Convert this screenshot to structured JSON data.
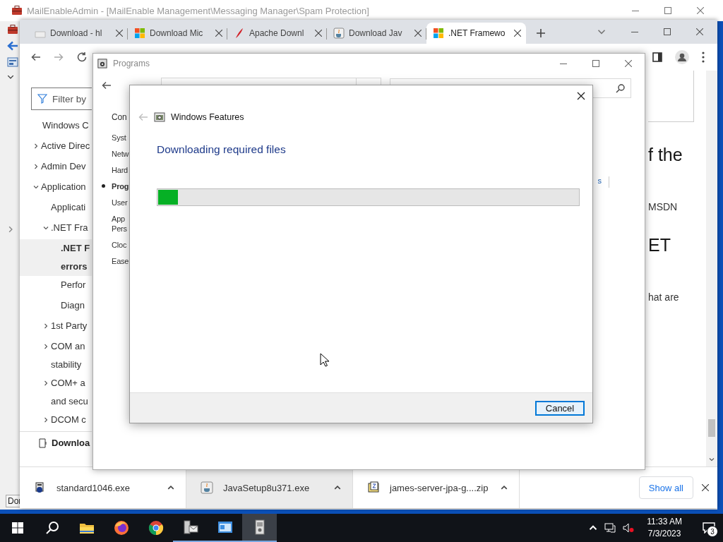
{
  "mail_window": {
    "title": "MailEnableAdmin - [MailEnable Management\\Messaging Manager\\Spam Protection]",
    "status_text": "Dor"
  },
  "browser": {
    "tabs": [
      {
        "label": "Download - hl",
        "selected": false
      },
      {
        "label": "Download Mic",
        "selected": false
      },
      {
        "label": "Apache Downl",
        "selected": false
      },
      {
        "label": "Download Jav",
        "selected": false
      },
      {
        "label": ".NET Framewo",
        "selected": true
      }
    ],
    "docs_sidebar": {
      "filter_placeholder": "Filter by",
      "tree": [
        {
          "lines": [
            "Windows C"
          ],
          "selected": false
        },
        {
          "lines": [
            "Active Direc"
          ],
          "expanded": false,
          "selected": false
        },
        {
          "lines": [
            "Admin Dev"
          ],
          "expanded": false,
          "selected": false
        },
        {
          "lines": [
            "Application"
          ],
          "expanded": true,
          "selected": false,
          "children": [
            {
              "lines": [
                "Applicati"
              ],
              "selected": false
            },
            {
              "lines": [
                ".NET Fra"
              ],
              "expanded": true,
              "selected": false,
              "children": [
                {
                  "lines": [
                    ".NET F",
                    "errors"
                  ],
                  "selected": true
                },
                {
                  "lines": [
                    "Perfor"
                  ],
                  "selected": false
                },
                {
                  "lines": [
                    "Diagn"
                  ],
                  "selected": false
                }
              ]
            },
            {
              "lines": [
                "1st Party"
              ],
              "expanded": false,
              "selected": false
            },
            {
              "lines": [
                "COM an",
                "stability"
              ],
              "expanded": false,
              "selected": false
            },
            {
              "lines": [
                "COM+ a",
                "and secu"
              ],
              "expanded": false,
              "selected": false
            },
            {
              "lines": [
                "DCOM c"
              ],
              "expanded": false,
              "selected": false
            }
          ]
        }
      ],
      "downloads_button": "Downloa"
    },
    "article_fragments": [
      {
        "kind": "heading",
        "text": "f the"
      },
      {
        "kind": "paragraph",
        "text": "MSDN"
      },
      {
        "kind": "heading",
        "text": "ET"
      },
      {
        "kind": "paragraph",
        "text": "hat are"
      }
    ],
    "download_shelf": {
      "items": [
        {
          "name": "standard1046.exe",
          "selected": false
        },
        {
          "name": "JavaSetup8u371.exe",
          "selected": true
        },
        {
          "name": "james-server-jpa-g....zip",
          "selected": false
        }
      ],
      "show_all": "Show all"
    }
  },
  "programs_window": {
    "title": "Programs",
    "nav_heading": "Con",
    "nav": [
      {
        "lines": [
          "Syst"
        ],
        "selected": false
      },
      {
        "lines": [
          "Netw"
        ],
        "selected": false
      },
      {
        "lines": [
          "Hard"
        ],
        "selected": false
      },
      {
        "lines": [
          "Prog"
        ],
        "selected": true
      },
      {
        "lines": [
          "User"
        ],
        "selected": false
      },
      {
        "lines": [
          "App",
          "Pers"
        ],
        "selected": false
      },
      {
        "lines": [
          "Cloc"
        ],
        "selected": false
      },
      {
        "lines": [
          "Ease"
        ],
        "selected": false
      }
    ],
    "link_fragment": "s"
  },
  "features_dialog": {
    "title": "Windows Features",
    "heading": "Downloading required files",
    "progress": {
      "level": 0.047
    },
    "buttons": [
      {
        "label": "Cancel",
        "focused": true
      }
    ]
  },
  "taskbar": {
    "apps": [
      {
        "running": false,
        "active": false
      },
      {
        "running": false,
        "active": false
      },
      {
        "running": false,
        "active": false
      },
      {
        "running": true,
        "active": false
      },
      {
        "running": true,
        "active": false
      },
      {
        "running": true,
        "active": true
      }
    ],
    "time": "11:33 AM",
    "date": "7/3/2023",
    "notifications": "3"
  }
}
